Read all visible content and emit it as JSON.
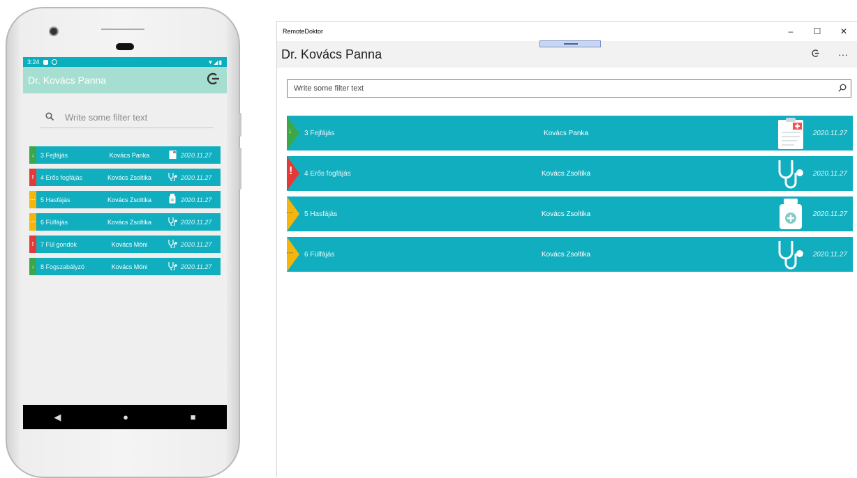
{
  "phone": {
    "status_time": "3:24",
    "title": "Dr. Kovács Panna",
    "search_placeholder": "Write some filter text",
    "rows": [
      {
        "flag": "↓",
        "label": "3 Fejfájás",
        "patient": "Kovács Panka",
        "icon": "clipboard-icon",
        "date": "2020.11.27"
      },
      {
        "flag": "!",
        "label": "4 Erős fogfájás",
        "patient": "Kovács Zsoltika",
        "icon": "stethoscope-icon",
        "date": "2020.11.27"
      },
      {
        "flag": "···",
        "label": "5 Hasfájás",
        "patient": "Kovács Zsoltika",
        "icon": "medicine-bottle-icon",
        "date": "2020.11.27"
      },
      {
        "flag": "···",
        "label": "6 Fülfájás",
        "patient": "Kovács Zsoltika",
        "icon": "stethoscope-icon",
        "date": "2020.11.27"
      },
      {
        "flag": "!",
        "label": "7 Fül gondok",
        "patient": "Kovács Móni",
        "icon": "stethoscope-icon",
        "date": "2020.11.27"
      },
      {
        "flag": "↓",
        "label": "8 Fogszabályzó",
        "patient": "Kovács Móni",
        "icon": "stethoscope-icon",
        "date": "2020.11.27"
      }
    ]
  },
  "window": {
    "app_name": "RemoteDoktor",
    "title": "Dr. Kovács Panna",
    "search_placeholder": "Write some filter text",
    "rows": [
      {
        "flag": "↓",
        "label": "3 Fejfájás",
        "patient": "Kovács Panka",
        "icon": "clipboard-icon",
        "date": "2020.11.27"
      },
      {
        "flag": "!",
        "label": "4 Erős fogfájás",
        "patient": "Kovács Zsoltika",
        "icon": "stethoscope-icon",
        "date": "2020.11.27"
      },
      {
        "flag": "···",
        "label": "5 Hasfájás",
        "patient": "Kovács Zsoltika",
        "icon": "medicine-bottle-icon",
        "date": "2020.11.27"
      },
      {
        "flag": "···",
        "label": "6 Fülfájás",
        "patient": "Kovács Zsoltika",
        "icon": "stethoscope-icon",
        "date": "2020.11.27"
      }
    ]
  },
  "colors": {
    "row_bg": "#11aec0",
    "android_appbar": "#a6dfd1",
    "status_bar": "#0aaebc",
    "flag_low": "#3aa84a",
    "flag_urgent": "#e53935",
    "flag_pending": "#f5b50b"
  }
}
